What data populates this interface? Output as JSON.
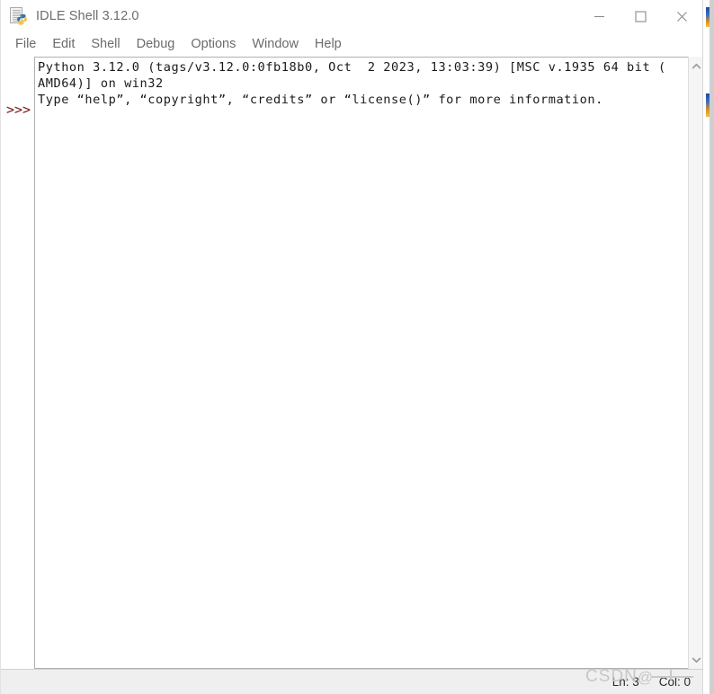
{
  "window": {
    "title": "IDLE Shell 3.12.0",
    "icon": "python-document-icon",
    "controls": {
      "minimize": "minimize-icon",
      "maximize": "maximize-icon",
      "close": "close-icon"
    }
  },
  "menubar": {
    "items": [
      {
        "label": "File"
      },
      {
        "label": "Edit"
      },
      {
        "label": "Shell"
      },
      {
        "label": "Debug"
      },
      {
        "label": "Options"
      },
      {
        "label": "Window"
      },
      {
        "label": "Help"
      }
    ]
  },
  "shell": {
    "prompt": ">>>",
    "prompt_color": "#7a1616",
    "lines": [
      "Python 3.12.0 (tags/v3.12.0:0fb18b0, Oct  2 2023, 13:03:39) [MSC v.1935 64 bit (",
      "AMD64)] on win32",
      "Type “help”, “copyright”, “credits” or “license()” for more information."
    ]
  },
  "scrollbar": {
    "up_arrow": "chevron-up-icon",
    "down_arrow": "chevron-down-icon"
  },
  "statusbar": {
    "line": "Ln: 3",
    "column": "Col: 0"
  },
  "watermark": {
    "text": "CSDN",
    "at": "@"
  },
  "colors": {
    "title_text": "#6d6d6d",
    "menu_text": "#6b6b6b",
    "console_text": "#1a1a1a",
    "prompt": "#7a1616",
    "statusbar_bg": "#efefef",
    "watermark": "#c7c7c7"
  }
}
